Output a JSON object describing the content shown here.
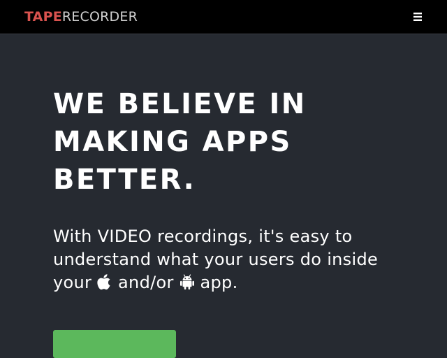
{
  "navbar": {
    "brand_primary": "TAPE",
    "brand_secondary": "RECORDER",
    "menu_icon": "hamburger-menu-icon",
    "background": "#000000",
    "brand_primary_color": "#d9534f"
  },
  "hero": {
    "headline": "WE BELIEVE IN MAKING APPS BETTER.",
    "tagline_part1": "With VIDEO recordings, it's easy to understand what your users do inside your",
    "tagline_part2": "and/or",
    "tagline_part3": "app.",
    "icons": [
      "apple-icon",
      "android-icon"
    ],
    "background": "#262a31",
    "cta_color": "#5cb85c"
  }
}
